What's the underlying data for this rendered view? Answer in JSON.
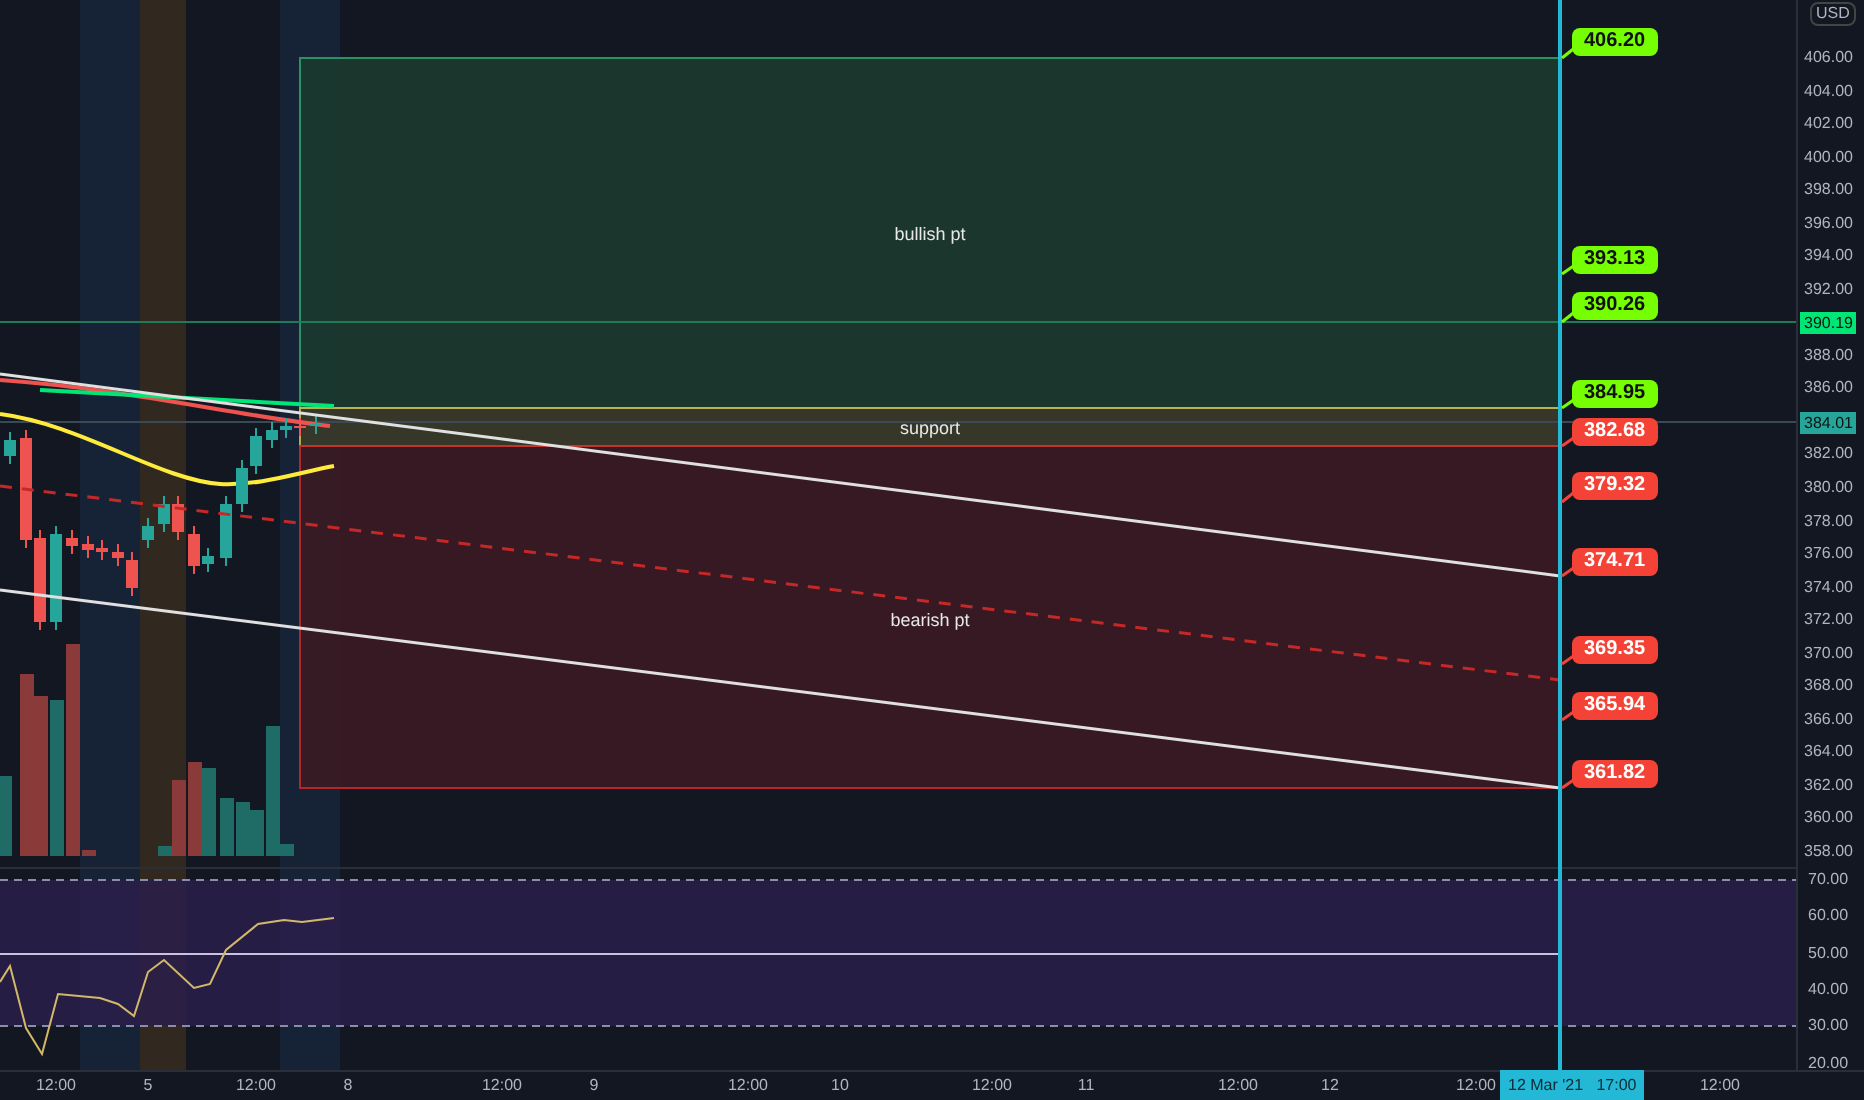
{
  "zones": [
    {
      "kind": "bullish",
      "label": "bullish pt"
    },
    {
      "kind": "support",
      "label": "support"
    },
    {
      "kind": "bearish",
      "label": "bearish pt"
    }
  ],
  "callouts": [
    {
      "text": "406.20",
      "color": "#76ff03"
    },
    {
      "text": "393.13",
      "color": "#76ff03"
    },
    {
      "text": "390.26",
      "color": "#76ff03"
    },
    {
      "text": "384.95",
      "color": "#76ff03"
    },
    {
      "text": "382.68",
      "color": "#f44336"
    },
    {
      "text": "379.32",
      "color": "#f44336"
    },
    {
      "text": "374.71",
      "color": "#f44336"
    },
    {
      "text": "369.35",
      "color": "#f44336"
    },
    {
      "text": "365.94",
      "color": "#f44336"
    },
    {
      "text": "361.82",
      "color": "#f44336"
    }
  ],
  "price_axis": {
    "currency": "USD",
    "labels": [
      "406.00",
      "404.00",
      "402.00",
      "400.00",
      "398.00",
      "396.00",
      "394.00",
      "392.00",
      "388.00",
      "386.00",
      "382.00",
      "380.00",
      "378.00",
      "376.00",
      "374.00",
      "372.00",
      "370.00",
      "368.00",
      "366.00",
      "364.00",
      "362.00",
      "360.00",
      "358.00"
    ],
    "markers": [
      {
        "text": "390.19",
        "color": "#00e676"
      },
      {
        "text": "384.01",
        "color": "#26a69a"
      }
    ]
  },
  "rsi_axis": {
    "labels": [
      "70.00",
      "60.00",
      "50.00",
      "40.00",
      "30.00",
      "20.00"
    ]
  },
  "time_axis": {
    "labels": [
      "12:00",
      "5",
      "12:00",
      "8",
      "12:00",
      "9",
      "12:00",
      "10",
      "12:00",
      "11",
      "12:00",
      "12",
      "12:00",
      "12:00"
    ],
    "crosshair_label": "12 Mar '21   17:00"
  }
}
